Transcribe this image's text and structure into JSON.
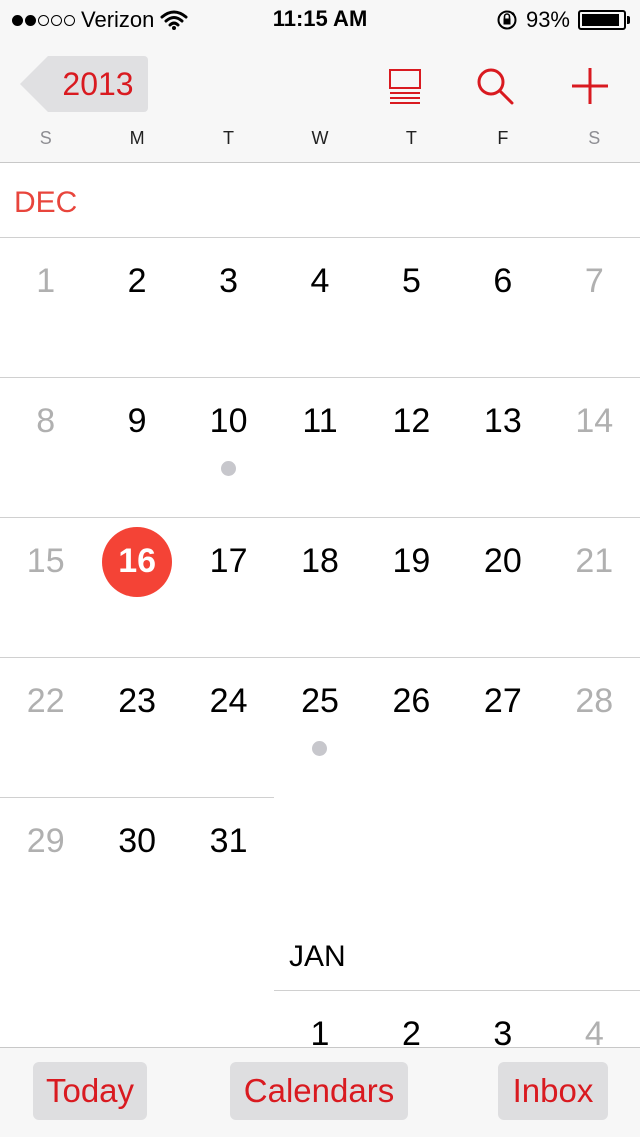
{
  "status_bar": {
    "carrier": "Verizon",
    "time": "11:15 AM",
    "battery": "93%",
    "battery_level": 0.93,
    "signal_bars_filled": 2,
    "signal_bars_total": 5,
    "icons": [
      "wifi-icon",
      "rotation-lock-icon",
      "battery-icon"
    ]
  },
  "nav": {
    "back_label": "2013",
    "accent_color": "#d91a20",
    "icons": [
      "list-view-icon",
      "search-icon",
      "add-icon"
    ],
    "weekdays": [
      "S",
      "M",
      "T",
      "W",
      "T",
      "F",
      "S"
    ]
  },
  "calendar": {
    "months": [
      {
        "label": "DEC",
        "label_color": "#e8453c",
        "weeks": [
          [
            "1",
            "2",
            "3",
            "4",
            "5",
            "6",
            "7"
          ],
          [
            "8",
            "9",
            "10",
            "11",
            "12",
            "13",
            "14"
          ],
          [
            "15",
            "16",
            "17",
            "18",
            "19",
            "20",
            "21"
          ],
          [
            "22",
            "23",
            "24",
            "25",
            "26",
            "27",
            "28"
          ],
          [
            "29",
            "30",
            "31"
          ]
        ]
      },
      {
        "label": "JAN",
        "label_color": "#000000",
        "weeks": [
          [
            "1",
            "2",
            "3",
            "4"
          ]
        ]
      }
    ],
    "today": "16",
    "today_color": "#f44336",
    "event_days": [
      "10",
      "25"
    ]
  },
  "toolbar": {
    "today_label": "Today",
    "calendars_label": "Calendars",
    "inbox_label": "Inbox"
  }
}
